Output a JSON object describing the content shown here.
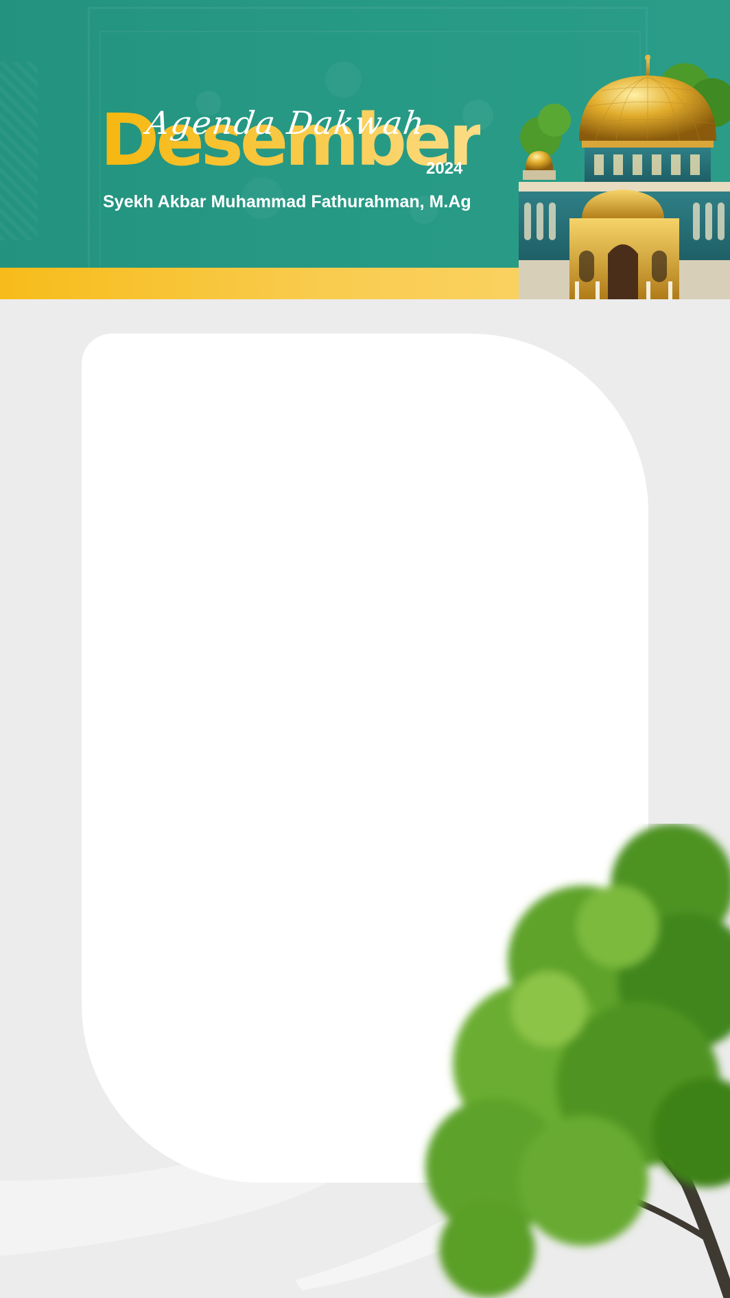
{
  "header": {
    "subtitle": "Agenda Dakwah",
    "title": "Desember",
    "year": "2024",
    "speaker": "Syekh Akbar Muhammad Fathurahman, M.Ag"
  },
  "colors": {
    "header_teal": "#23937f",
    "gold": "#f7bc1a",
    "background": "#ececec",
    "card": "#ffffff",
    "tree_green": "#5a9a22"
  },
  "illustrations": [
    "mosque-dome-illustration",
    "tree-illustration"
  ]
}
